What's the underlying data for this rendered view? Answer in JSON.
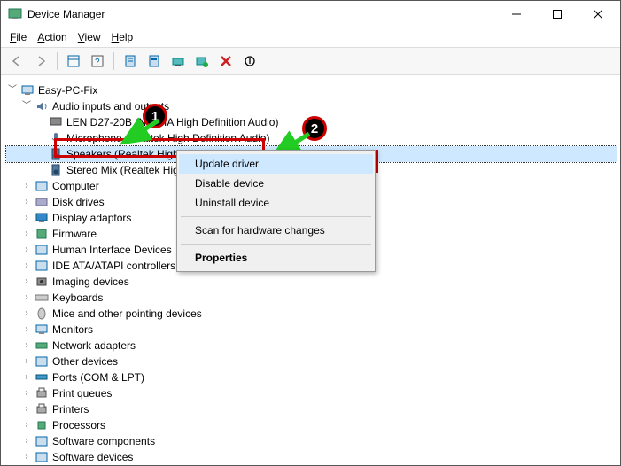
{
  "window": {
    "title": "Device Manager"
  },
  "menu": {
    "file": "File",
    "action": "Action",
    "view": "View",
    "help": "Help"
  },
  "tree": {
    "root": "Easy-PC-Fix",
    "audio_category": "Audio inputs and outputs",
    "audio_items": [
      "LEN D27-20B (NVIDIA High Definition Audio)",
      "Microphone (Realtek High Definition Audio)",
      "Speakers (Realtek High Definition Audio)",
      "Stereo Mix (Realtek High Definition Audio)"
    ],
    "categories": [
      "Computer",
      "Disk drives",
      "Display adaptors",
      "Firmware",
      "Human Interface Devices",
      "IDE ATA/ATAPI controllers",
      "Imaging devices",
      "Keyboards",
      "Mice and other pointing devices",
      "Monitors",
      "Network adapters",
      "Other devices",
      "Ports (COM & LPT)",
      "Print queues",
      "Printers",
      "Processors",
      "Software components",
      "Software devices"
    ]
  },
  "context_menu": {
    "update": "Update driver",
    "disable": "Disable device",
    "uninstall": "Uninstall device",
    "scan": "Scan for hardware changes",
    "properties": "Properties"
  },
  "annotations": {
    "step1": "1",
    "step2": "2"
  }
}
